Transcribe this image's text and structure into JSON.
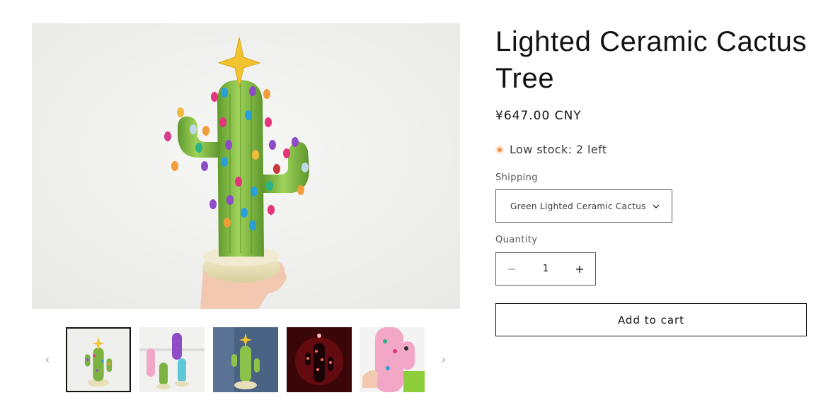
{
  "product": {
    "title": "Lighted Ceramic Cactus Tree",
    "price": "¥647.00 CNY",
    "stock": "Low stock: 2 left",
    "stock_color": "#ee8d4a"
  },
  "shipping": {
    "label": "Shipping",
    "selected": "Green Lighted Ceramic Cactus"
  },
  "quantity": {
    "label": "Quantity",
    "value": "1"
  },
  "cart": {
    "add_label": "Add to cart"
  },
  "gallery": {
    "prev_icon": "‹",
    "next_icon": "›",
    "active_index": 0,
    "thumbnails": [
      {
        "name": "thumb-green-cactus"
      },
      {
        "name": "thumb-cactus-collection"
      },
      {
        "name": "thumb-cactus-blue-background"
      },
      {
        "name": "thumb-cactus-lit-dark"
      },
      {
        "name": "thumb-pink-cactus"
      }
    ]
  },
  "colors": {
    "cactus_green": "#7cb342",
    "star_gold": "#f4c430",
    "border": "#121212"
  }
}
